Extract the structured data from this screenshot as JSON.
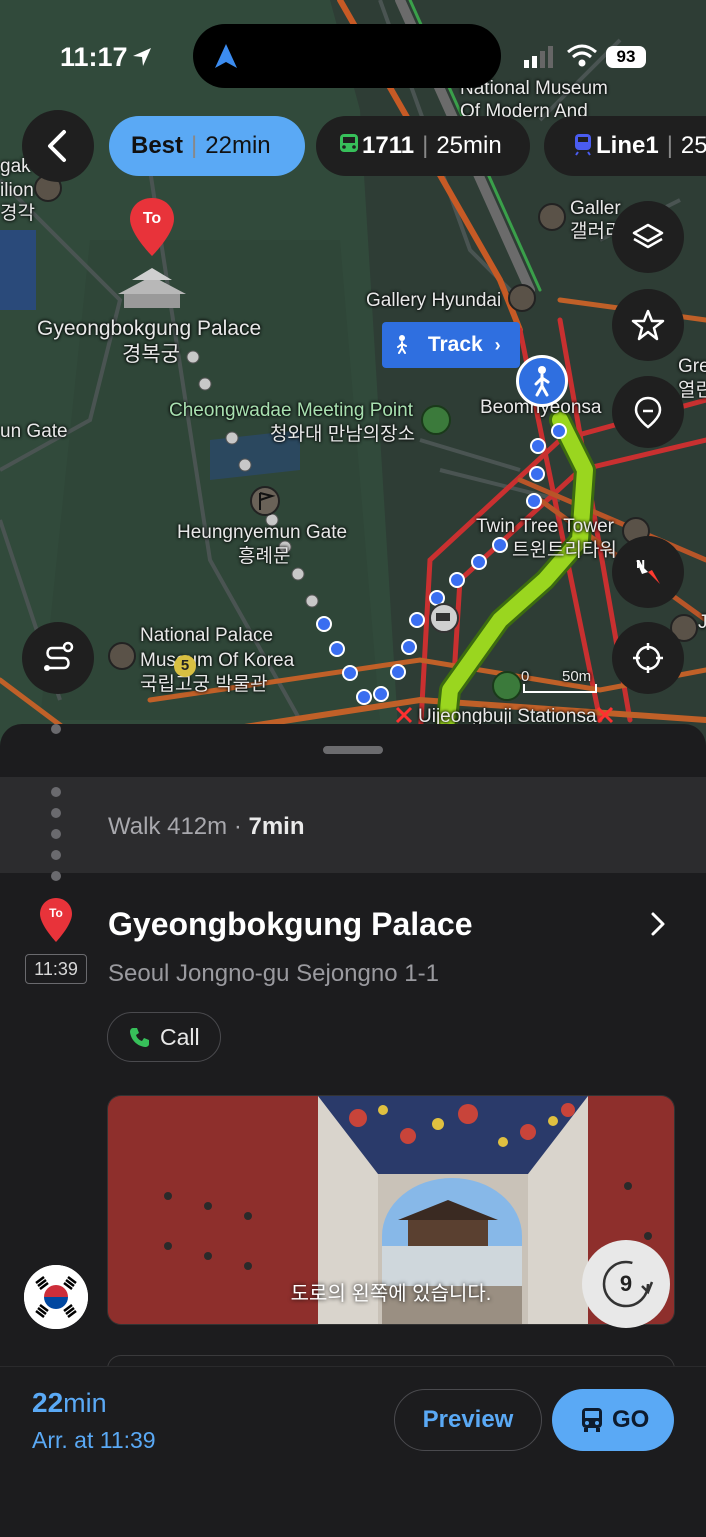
{
  "status_bar": {
    "time": "11:17",
    "battery": "93"
  },
  "route_tabs": [
    {
      "mode": "best",
      "label": "Best",
      "duration": "22min",
      "active": true
    },
    {
      "mode": "bus",
      "label": "1711",
      "duration": "25min",
      "active": false
    },
    {
      "mode": "subway",
      "label": "Line1",
      "duration": "25",
      "active": false
    }
  ],
  "map": {
    "destination_pin": "To",
    "track_button": "Track",
    "labels": {
      "palace_en": "Gyeongbokgung Palace",
      "palace_ko": "경복궁",
      "mmca_line1": "National Museum",
      "mmca_line2": "Of Modern And",
      "gallery_top_en": "Galler",
      "gallery_top_ko": "갤러리",
      "gallery_hyundai": "Gallery Hyundai",
      "cheongwadae_en": "Cheongwadae Meeting Point",
      "cheongwadae_ko": "청와대 만남의장소",
      "beomnyeonsa": "Beomnyeonsa",
      "un_gate": "un Gate",
      "heungnyemun_en": "Heungnyemun Gate",
      "heungnyemun_ko": "흥례문",
      "twin_tree_en": "Twin Tree Tower",
      "twin_tree_ko": "트윈트리타워",
      "npm_line1": "National Palace",
      "npm_line2": "Museum Of Korea",
      "npm_ko": "국립고궁 박물관",
      "uijeongbu": "Uijeongbuji Stationsa",
      "left_edge_1": "gak",
      "left_edge_2": "ilion",
      "left_edge_3": "경각",
      "right_edge_1": "Gre",
      "right_edge_2": "열린",
      "right_edge_3": "J",
      "bus_stop": "5",
      "scale_zero": "0",
      "scale_label": "50m"
    }
  },
  "sheet": {
    "walk_label": "Walk 412m",
    "walk_sep": " · ",
    "walk_time": "7min",
    "pin_label": "To",
    "arrival_time": "11:39",
    "place_title": "Gyeongbokgung Palace",
    "place_address": "Seoul Jongno-gu Sejongno 1-1",
    "call_label": "Call",
    "photo_caption": "도로의 왼쪽에 있습니다.",
    "rotate_count": "9"
  },
  "bottom": {
    "duration_value": "22",
    "duration_unit": "min",
    "arrival": "Arr. at 11:39",
    "preview_label": "Preview",
    "go_label": "GO"
  },
  "colors": {
    "accent": "#5aa9f5",
    "route_walk": "#2f6fe0",
    "route_green": "#9ad61f",
    "pin_red": "#e8333a"
  }
}
